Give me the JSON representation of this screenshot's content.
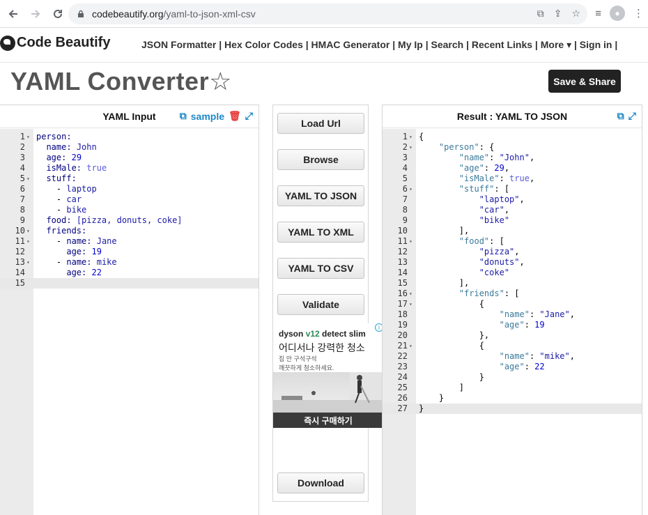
{
  "browser": {
    "url_host": "codebeautify.org",
    "url_path": "/yaml-to-json-xml-csv"
  },
  "site": {
    "logo_text": "Code Beautify",
    "nav_text": "JSON Formatter | Hex Color Codes | HMAC Generator | My Ip |   Search |   Recent Links |   More ▾ |   Sign in |"
  },
  "page": {
    "title": "YAML Converter",
    "save_share": "Save & Share"
  },
  "left_panel": {
    "title": "YAML Input",
    "sample": "sample",
    "lines": [
      {
        "n": "1",
        "fold": true,
        "html": "<span class='k'>person:</span>"
      },
      {
        "n": "2",
        "fold": false,
        "html": "  <span class='k'>name:</span> <span class='s'>John</span>"
      },
      {
        "n": "3",
        "fold": false,
        "html": "  <span class='k'>age:</span> <span class='n'>29</span>"
      },
      {
        "n": "4",
        "fold": false,
        "html": "  <span class='k'>isMale:</span> <span class='kw'>true</span>"
      },
      {
        "n": "5",
        "fold": true,
        "html": "  <span class='k'>stuff:</span>"
      },
      {
        "n": "6",
        "fold": false,
        "html": "    <span class='punct'>-</span> <span class='s'>laptop</span>"
      },
      {
        "n": "7",
        "fold": false,
        "html": "    <span class='punct'>-</span> <span class='s'>car</span>"
      },
      {
        "n": "8",
        "fold": false,
        "html": "    <span class='punct'>-</span> <span class='s'>bike</span>"
      },
      {
        "n": "9",
        "fold": false,
        "html": "  <span class='k'>food:</span> <span class='s'>[pizza, donuts, coke]</span>"
      },
      {
        "n": "10",
        "fold": true,
        "html": "  <span class='k'>friends:</span>"
      },
      {
        "n": "11",
        "fold": true,
        "html": "    <span class='punct'>-</span> <span class='k'>name:</span> <span class='s'>Jane</span>"
      },
      {
        "n": "12",
        "fold": false,
        "html": "      <span class='k'>age:</span> <span class='n'>19</span>"
      },
      {
        "n": "13",
        "fold": true,
        "html": "    <span class='punct'>-</span> <span class='k'>name:</span> <span class='s'>mike</span>"
      },
      {
        "n": "14",
        "fold": false,
        "html": "      <span class='k'>age:</span> <span class='n'>22</span>"
      },
      {
        "n": "15",
        "fold": false,
        "html": "",
        "active": true
      }
    ]
  },
  "middle": {
    "buttons": [
      "Load Url",
      "Browse",
      "YAML TO JSON",
      "YAML TO XML",
      "YAML TO CSV",
      "Validate"
    ],
    "download": "Download",
    "ad": {
      "brand_a": "dyson",
      "brand_b": "v12",
      "brand_c": " detect slim",
      "headline": "어디서나 강력한 청소",
      "sub1": "집 안 구석구석",
      "sub2": "깨끗하게 청소하세요.",
      "cta": "즉시 구매하기"
    }
  },
  "right_panel": {
    "title": "Result : YAML TO JSON",
    "lines": [
      {
        "n": "1",
        "fold": true,
        "html": "<span class='punct'>{</span>"
      },
      {
        "n": "2",
        "fold": true,
        "html": "    <span class='j-key'>\"person\"</span><span class='punct'>: {</span>"
      },
      {
        "n": "3",
        "fold": false,
        "html": "        <span class='j-key'>\"name\"</span><span class='punct'>: </span><span class='j-str'>\"John\"</span><span class='punct'>,</span>"
      },
      {
        "n": "4",
        "fold": false,
        "html": "        <span class='j-key'>\"age\"</span><span class='punct'>: </span><span class='j-num'>29</span><span class='punct'>,</span>"
      },
      {
        "n": "5",
        "fold": false,
        "html": "        <span class='j-key'>\"isMale\"</span><span class='punct'>: </span><span class='j-bool'>true</span><span class='punct'>,</span>"
      },
      {
        "n": "6",
        "fold": true,
        "html": "        <span class='j-key'>\"stuff\"</span><span class='punct'>: [</span>"
      },
      {
        "n": "7",
        "fold": false,
        "html": "            <span class='j-str'>\"laptop\"</span><span class='punct'>,</span>"
      },
      {
        "n": "8",
        "fold": false,
        "html": "            <span class='j-str'>\"car\"</span><span class='punct'>,</span>"
      },
      {
        "n": "9",
        "fold": false,
        "html": "            <span class='j-str'>\"bike\"</span>"
      },
      {
        "n": "10",
        "fold": false,
        "html": "        <span class='punct'>],</span>"
      },
      {
        "n": "11",
        "fold": true,
        "html": "        <span class='j-key'>\"food\"</span><span class='punct'>: [</span>"
      },
      {
        "n": "12",
        "fold": false,
        "html": "            <span class='j-str'>\"pizza\"</span><span class='punct'>,</span>"
      },
      {
        "n": "13",
        "fold": false,
        "html": "            <span class='j-str'>\"donuts\"</span><span class='punct'>,</span>"
      },
      {
        "n": "14",
        "fold": false,
        "html": "            <span class='j-str'>\"coke\"</span>"
      },
      {
        "n": "15",
        "fold": false,
        "html": "        <span class='punct'>],</span>"
      },
      {
        "n": "16",
        "fold": true,
        "html": "        <span class='j-key'>\"friends\"</span><span class='punct'>: [</span>"
      },
      {
        "n": "17",
        "fold": true,
        "html": "            <span class='punct'>{</span>"
      },
      {
        "n": "18",
        "fold": false,
        "html": "                <span class='j-key'>\"name\"</span><span class='punct'>: </span><span class='j-str'>\"Jane\"</span><span class='punct'>,</span>"
      },
      {
        "n": "19",
        "fold": false,
        "html": "                <span class='j-key'>\"age\"</span><span class='punct'>: </span><span class='j-num'>19</span>"
      },
      {
        "n": "20",
        "fold": false,
        "html": "            <span class='punct'>},</span>"
      },
      {
        "n": "21",
        "fold": true,
        "html": "            <span class='punct'>{</span>"
      },
      {
        "n": "22",
        "fold": false,
        "html": "                <span class='j-key'>\"name\"</span><span class='punct'>: </span><span class='j-str'>\"mike\"</span><span class='punct'>,</span>"
      },
      {
        "n": "23",
        "fold": false,
        "html": "                <span class='j-key'>\"age\"</span><span class='punct'>: </span><span class='j-num'>22</span>"
      },
      {
        "n": "24",
        "fold": false,
        "html": "            <span class='punct'>}</span>"
      },
      {
        "n": "25",
        "fold": false,
        "html": "        <span class='punct'>]</span>"
      },
      {
        "n": "26",
        "fold": false,
        "html": "    <span class='punct'>}</span>"
      },
      {
        "n": "27",
        "fold": false,
        "html": "<span class='punct'>}</span>",
        "active": true
      }
    ]
  },
  "colors": {
    "accent_blue": "#1e88c7",
    "delete_red": "#e53935",
    "dark_button": "#222222"
  }
}
